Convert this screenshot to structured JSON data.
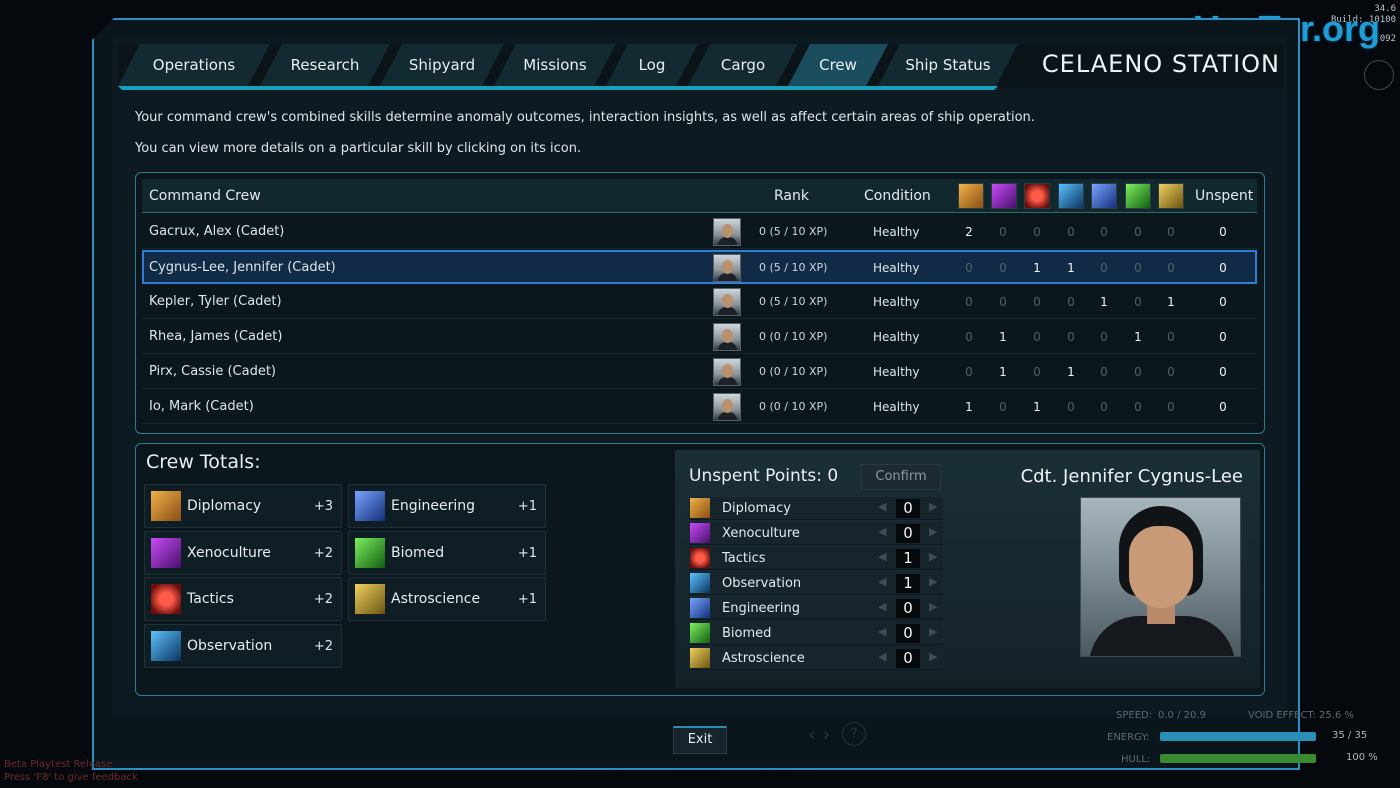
{
  "hud": {
    "fps": "34.6",
    "build": "Build: 10100",
    "side_num": "092"
  },
  "watermark": "VseTor.org",
  "tabs": [
    {
      "label": "Operations"
    },
    {
      "label": "Research"
    },
    {
      "label": "Shipyard"
    },
    {
      "label": "Missions"
    },
    {
      "label": "Log"
    },
    {
      "label": "Cargo"
    },
    {
      "label": "Crew"
    },
    {
      "label": "Ship Status"
    }
  ],
  "station_title": "CELAENO STATION",
  "intro": {
    "line1": "Your command crew's combined skills determine anomaly outcomes, interaction insights, as well as affect certain areas of ship operation.",
    "line2": "You can view more details on a particular skill by clicking on its icon."
  },
  "table": {
    "headers": {
      "crew": "Command Crew",
      "rank": "Rank",
      "condition": "Condition",
      "unspent": "Unspent"
    },
    "skill_icons": [
      "diplomacy-icon",
      "xenoculture-icon",
      "tactics-icon",
      "observation-icon",
      "engineering-icon",
      "biomed-icon",
      "astroscience-icon"
    ],
    "rows": [
      {
        "name": "Gacrux, Alex (Cadet)",
        "rank": "0 (5 / 10 XP)",
        "condition": "Healthy",
        "skills": [
          "2",
          "0",
          "0",
          "0",
          "0",
          "0",
          "0"
        ],
        "unspent": "0"
      },
      {
        "name": "Cygnus-Lee, Jennifer (Cadet)",
        "rank": "0 (5 / 10 XP)",
        "condition": "Healthy",
        "skills": [
          "0",
          "0",
          "1",
          "1",
          "0",
          "0",
          "0"
        ],
        "unspent": "0"
      },
      {
        "name": "Kepler, Tyler (Cadet)",
        "rank": "0 (5 / 10 XP)",
        "condition": "Healthy",
        "skills": [
          "0",
          "0",
          "0",
          "0",
          "1",
          "0",
          "1"
        ],
        "unspent": "0"
      },
      {
        "name": "Rhea, James (Cadet)",
        "rank": "0 (0 / 10 XP)",
        "condition": "Healthy",
        "skills": [
          "0",
          "1",
          "0",
          "0",
          "0",
          "1",
          "0"
        ],
        "unspent": "0"
      },
      {
        "name": "Pirx, Cassie (Cadet)",
        "rank": "0 (0 / 10 XP)",
        "condition": "Healthy",
        "skills": [
          "0",
          "1",
          "0",
          "1",
          "0",
          "0",
          "0"
        ],
        "unspent": "0"
      },
      {
        "name": "Io, Mark (Cadet)",
        "rank": "0 (0 / 10 XP)",
        "condition": "Healthy",
        "skills": [
          "1",
          "0",
          "1",
          "0",
          "0",
          "0",
          "0"
        ],
        "unspent": "0"
      }
    ]
  },
  "totals": {
    "title": "Crew Totals:",
    "items": [
      {
        "name": "Diplomacy",
        "value": "+3"
      },
      {
        "name": "Xenoculture",
        "value": "+2"
      },
      {
        "name": "Tactics",
        "value": "+2"
      },
      {
        "name": "Observation",
        "value": "+2"
      },
      {
        "name": "Engineering",
        "value": "+1"
      },
      {
        "name": "Biomed",
        "value": "+1"
      },
      {
        "name": "Astroscience",
        "value": "+1"
      }
    ]
  },
  "detail": {
    "unspent_label": "Unspent Points: 0",
    "confirm_label": "Confirm",
    "officer_name": "Cdt. Jennifer Cygnus-Lee",
    "skills": [
      {
        "name": "Diplomacy",
        "value": "0"
      },
      {
        "name": "Xenoculture",
        "value": "0"
      },
      {
        "name": "Tactics",
        "value": "1"
      },
      {
        "name": "Observation",
        "value": "1"
      },
      {
        "name": "Engineering",
        "value": "0"
      },
      {
        "name": "Biomed",
        "value": "0"
      },
      {
        "name": "Astroscience",
        "value": "0"
      }
    ]
  },
  "exit_label": "Exit",
  "footer": {
    "line1": "Beta Playtest Release",
    "line2": "Press 'F8' to give feedback"
  },
  "status": {
    "speed_label": "SPEED:",
    "speed_value": "0.0 / 20.9",
    "void_label": "VOID EFFECT: 25.6 %",
    "energy_label": "ENERGY:",
    "energy_value": "35 / 35",
    "energy_fraction": 1.0,
    "hull_label": "HULL:",
    "hull_value": "100 %",
    "hull_fraction": 1.0
  },
  "colors": {
    "diplomacy": "#c98a2e",
    "xenoculture": "#9b2fd1",
    "tactics": "#d6342b",
    "observation": "#2d8fd6",
    "engineering": "#3b6fd8",
    "biomed": "#3fc33a",
    "astroscience": "#c9a63a"
  }
}
